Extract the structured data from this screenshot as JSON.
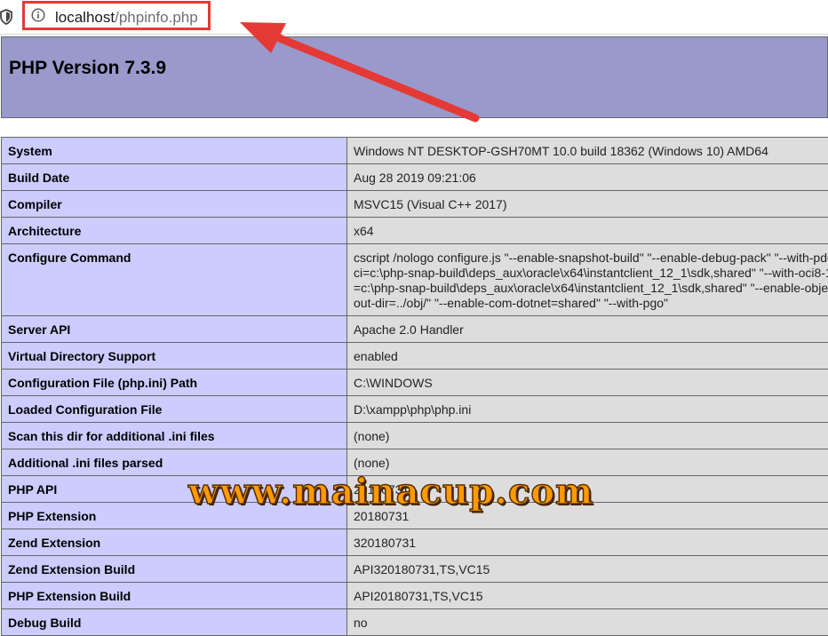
{
  "browser": {
    "url_host": "localhost",
    "url_path": "/phpinfo.php"
  },
  "header": {
    "title": "PHP Version 7.3.9"
  },
  "rows": [
    {
      "label": "System",
      "value": "Windows NT DESKTOP-GSH70MT 10.0 build 18362 (Windows 10) AMD64"
    },
    {
      "label": "Build Date",
      "value": "Aug 28 2019 09:21:06"
    },
    {
      "label": "Compiler",
      "value": "MSVC15 (Visual C++ 2017)"
    },
    {
      "label": "Architecture",
      "value": "x64"
    },
    {
      "label": "Configure Command",
      "value": "cscript /nologo configure.js \"--enable-snapshot-build\" \"--enable-debug-pack\" \"--with-pdo-oci=c:\\php-snap-build\\deps_aux\\oracle\\x64\\instantclient_12_1\\sdk,shared\" \"--with-oci8-12c=c:\\php-snap-build\\deps_aux\\oracle\\x64\\instantclient_12_1\\sdk,shared\" \"--enable-object-out-dir=../obj/\" \"--enable-com-dotnet=shared\" \"--with-pgo\""
    },
    {
      "label": "Server API",
      "value": "Apache 2.0 Handler"
    },
    {
      "label": "Virtual Directory Support",
      "value": "enabled"
    },
    {
      "label": "Configuration File (php.ini) Path",
      "value": "C:\\WINDOWS"
    },
    {
      "label": "Loaded Configuration File",
      "value": "D:\\xampp\\php\\php.ini"
    },
    {
      "label": "Scan this dir for additional .ini files",
      "value": "(none)"
    },
    {
      "label": "Additional .ini files parsed",
      "value": "(none)"
    },
    {
      "label": "PHP API",
      "value": "20180731"
    },
    {
      "label": "PHP Extension",
      "value": "20180731"
    },
    {
      "label": "Zend Extension",
      "value": "320180731"
    },
    {
      "label": "Zend Extension Build",
      "value": "API320180731,TS,VC15"
    },
    {
      "label": "PHP Extension Build",
      "value": "API20180731,TS,VC15"
    },
    {
      "label": "Debug Build",
      "value": "no"
    }
  ],
  "watermark": "www.mainacup.com",
  "colors": {
    "header_bg": "#9999cc",
    "label_bg": "#ccccff",
    "value_bg": "#dddddd",
    "highlight": "#e53935"
  }
}
